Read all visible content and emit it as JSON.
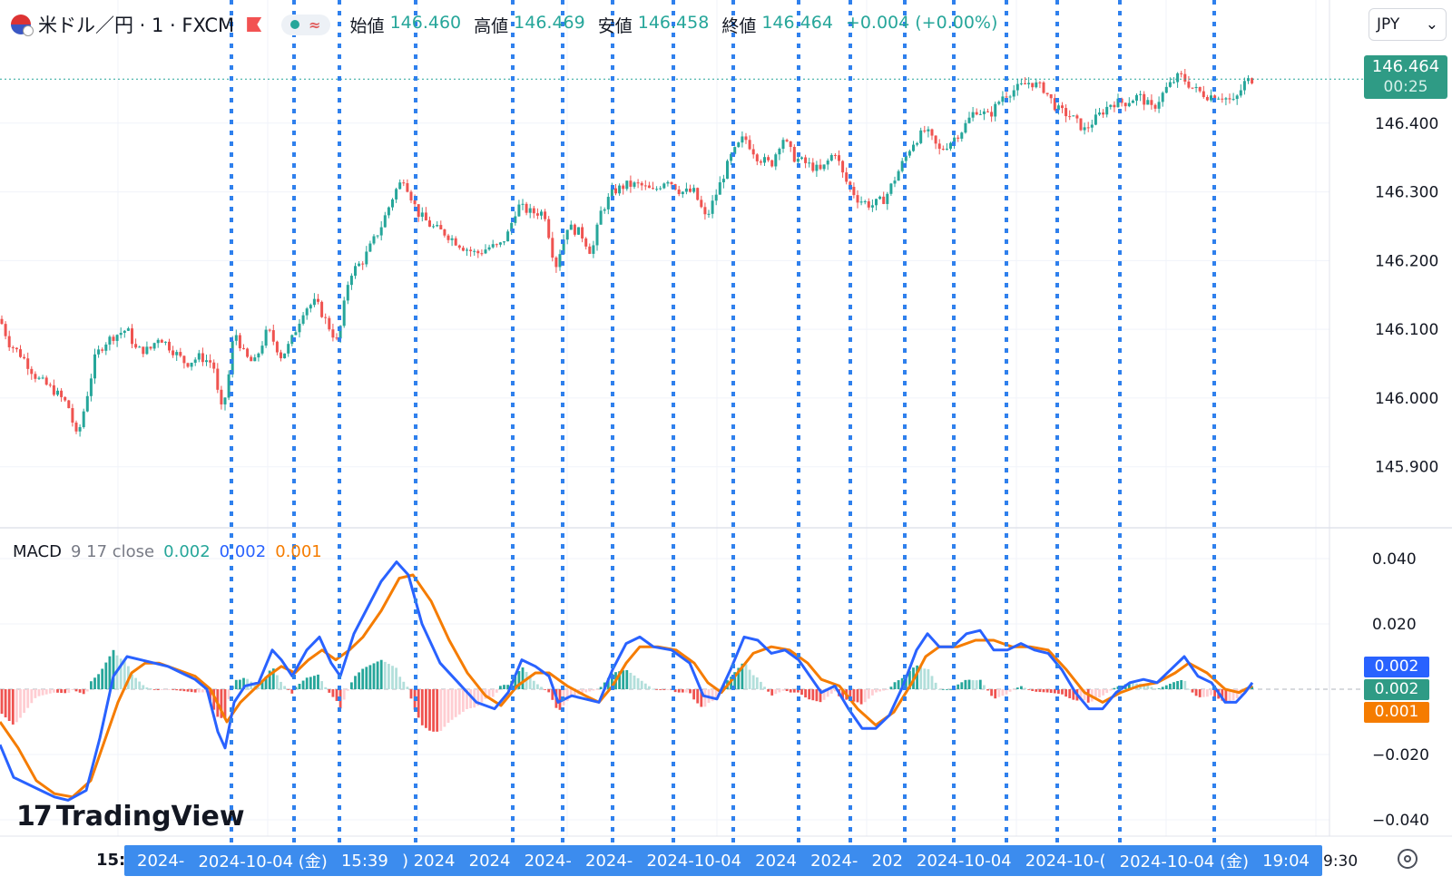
{
  "header": {
    "symbol": "米ドル／円 · 1 · FXCM",
    "wave_glyph": "≈",
    "ohlc": [
      {
        "label": "始値",
        "value": "146.460"
      },
      {
        "label": "高値",
        "value": "146.469"
      },
      {
        "label": "安値",
        "value": "146.458"
      },
      {
        "label": "終値",
        "value": "146.464"
      }
    ],
    "change": "+0.004 (+0.00%)"
  },
  "currency_selector": {
    "value": "JPY",
    "chevron": "chevron-down-icon"
  },
  "last_price_badge": {
    "price": "146.464",
    "countdown": "00:25"
  },
  "indicator": {
    "name": "MACD",
    "params": "9 17 close",
    "values": [
      "0.002",
      "0.002",
      "0.001"
    ],
    "badges": [
      "0.002",
      "0.002",
      "0.001"
    ]
  },
  "logo": {
    "mark": "17",
    "text": "TradingView"
  },
  "x_axis": {
    "left_cut": "15:",
    "labels": [
      "2024-",
      "2024-10-04 (金)",
      "15:39",
      ") 2024",
      "2024",
      "2024-",
      "2024-",
      "2024-10-04",
      "2024",
      "2024-",
      "202",
      "2024-10-04",
      "2024-10-(",
      "2024-10-04 (金)",
      "19:04"
    ],
    "right_cut": "9:30"
  },
  "colors": {
    "up": "#26a69a",
    "down": "#ef5350",
    "macd_line": "#2962ff",
    "signal_line": "#f57c00",
    "hist_up_strong": "#26a69a",
    "hist_up_weak": "#b2dfdb",
    "hist_down_strong": "#ef5350",
    "hist_down_weak": "#ffcdd2",
    "vline": "#2f80ed",
    "xbar": "#3c8cee"
  },
  "chart_data": [
    {
      "type": "candlestick",
      "ylim": [
        145.86,
        146.5
      ],
      "yticks": [
        "146.400",
        "146.300",
        "146.200",
        "146.100",
        "146.000",
        "145.900"
      ],
      "close_path": [
        [
          0,
          146.115
        ],
        [
          10,
          146.08
        ],
        [
          25,
          146.06
        ],
        [
          40,
          146.03
        ],
        [
          60,
          146.01
        ],
        [
          75,
          145.99
        ],
        [
          85,
          145.94
        ],
        [
          92,
          145.98
        ],
        [
          105,
          146.06
        ],
        [
          115,
          146.08
        ],
        [
          125,
          146.09
        ],
        [
          140,
          146.1
        ],
        [
          150,
          146.07
        ],
        [
          165,
          146.07
        ],
        [
          175,
          146.09
        ],
        [
          190,
          146.07
        ],
        [
          205,
          146.05
        ],
        [
          220,
          146.06
        ],
        [
          235,
          146.05
        ],
        [
          243,
          145.98
        ],
        [
          250,
          146.01
        ],
        [
          258,
          146.1
        ],
        [
          270,
          146.06
        ],
        [
          280,
          146.05
        ],
        [
          295,
          146.1
        ],
        [
          310,
          146.06
        ],
        [
          320,
          146.08
        ],
        [
          335,
          146.13
        ],
        [
          348,
          146.14
        ],
        [
          360,
          146.11
        ],
        [
          372,
          146.08
        ],
        [
          385,
          146.18
        ],
        [
          400,
          146.2
        ],
        [
          420,
          146.25
        ],
        [
          435,
          146.3
        ],
        [
          445,
          146.32
        ],
        [
          460,
          146.27
        ],
        [
          475,
          146.25
        ],
        [
          490,
          146.24
        ],
        [
          510,
          146.22
        ],
        [
          525,
          146.21
        ],
        [
          540,
          146.22
        ],
        [
          550,
          146.22
        ],
        [
          560,
          146.24
        ],
        [
          570,
          146.28
        ],
        [
          585,
          146.27
        ],
        [
          600,
          146.27
        ],
        [
          612,
          146.19
        ],
        [
          625,
          146.25
        ],
        [
          640,
          146.24
        ],
        [
          652,
          146.21
        ],
        [
          662,
          146.27
        ],
        [
          675,
          146.3
        ],
        [
          690,
          146.31
        ],
        [
          705,
          146.31
        ],
        [
          720,
          146.3
        ],
        [
          735,
          146.32
        ],
        [
          750,
          146.3
        ],
        [
          765,
          146.3
        ],
        [
          778,
          146.26
        ],
        [
          790,
          146.3
        ],
        [
          805,
          146.35
        ],
        [
          820,
          146.38
        ],
        [
          835,
          146.35
        ],
        [
          850,
          146.34
        ],
        [
          862,
          146.38
        ],
        [
          875,
          146.35
        ],
        [
          890,
          146.34
        ],
        [
          905,
          146.33
        ],
        [
          920,
          146.36
        ],
        [
          930,
          146.32
        ],
        [
          945,
          146.29
        ],
        [
          960,
          146.28
        ],
        [
          975,
          146.29
        ],
        [
          990,
          146.33
        ],
        [
          1005,
          146.37
        ],
        [
          1020,
          146.39
        ],
        [
          1035,
          146.36
        ],
        [
          1045,
          146.37
        ],
        [
          1060,
          146.39
        ],
        [
          1075,
          146.42
        ],
        [
          1090,
          146.41
        ],
        [
          1105,
          146.44
        ],
        [
          1120,
          146.45
        ],
        [
          1135,
          146.46
        ],
        [
          1150,
          146.45
        ],
        [
          1165,
          146.42
        ],
        [
          1180,
          146.41
        ],
        [
          1195,
          146.39
        ],
        [
          1210,
          146.41
        ],
        [
          1225,
          146.43
        ],
        [
          1240,
          146.43
        ],
        [
          1255,
          146.44
        ],
        [
          1270,
          146.42
        ],
        [
          1285,
          146.45
        ],
        [
          1300,
          146.47
        ],
        [
          1315,
          146.45
        ],
        [
          1330,
          146.44
        ],
        [
          1345,
          146.44
        ],
        [
          1360,
          146.43
        ],
        [
          1372,
          146.46
        ],
        [
          1380,
          146.464
        ]
      ]
    },
    {
      "type": "line",
      "title": "MACD 9 17 close",
      "ylim": [
        -0.045,
        0.045
      ],
      "yticks": [
        "0.040",
        "0.020",
        "−0.020",
        "−0.040"
      ],
      "series": [
        {
          "name": "",
          "role": "macd",
          "points": [
            [
              0,
              -0.017
            ],
            [
              15,
              -0.027
            ],
            [
              30,
              -0.029
            ],
            [
              45,
              -0.031
            ],
            [
              60,
              -0.033
            ],
            [
              75,
              -0.034
            ],
            [
              95,
              -0.031
            ],
            [
              110,
              -0.015
            ],
            [
              125,
              0.004
            ],
            [
              140,
              0.01
            ],
            [
              155,
              0.009
            ],
            [
              170,
              0.008
            ],
            [
              185,
              0.007
            ],
            [
              200,
              0.005
            ],
            [
              215,
              0.003
            ],
            [
              228,
              0.0
            ],
            [
              240,
              -0.013
            ],
            [
              248,
              -0.018
            ],
            [
              258,
              -0.004
            ],
            [
              270,
              0.001
            ],
            [
              285,
              0.002
            ],
            [
              300,
              0.012
            ],
            [
              310,
              0.009
            ],
            [
              322,
              0.004
            ],
            [
              338,
              0.012
            ],
            [
              352,
              0.016
            ],
            [
              365,
              0.008
            ],
            [
              375,
              0.004
            ],
            [
              390,
              0.017
            ],
            [
              405,
              0.025
            ],
            [
              420,
              0.033
            ],
            [
              437,
              0.039
            ],
            [
              450,
              0.035
            ],
            [
              465,
              0.02
            ],
            [
              485,
              0.008
            ],
            [
              505,
              0.002
            ],
            [
              525,
              -0.004
            ],
            [
              545,
              -0.006
            ],
            [
              560,
              -0.001
            ],
            [
              575,
              0.009
            ],
            [
              590,
              0.007
            ],
            [
              605,
              0.004
            ],
            [
              615,
              -0.004
            ],
            [
              630,
              -0.002
            ],
            [
              645,
              -0.003
            ],
            [
              660,
              -0.004
            ],
            [
              675,
              0.006
            ],
            [
              690,
              0.014
            ],
            [
              705,
              0.016
            ],
            [
              720,
              0.013
            ],
            [
              740,
              0.012
            ],
            [
              760,
              0.008
            ],
            [
              775,
              -0.002
            ],
            [
              790,
              -0.003
            ],
            [
              805,
              0.006
            ],
            [
              820,
              0.016
            ],
            [
              835,
              0.015
            ],
            [
              850,
              0.011
            ],
            [
              865,
              0.012
            ],
            [
              880,
              0.009
            ],
            [
              895,
              0.003
            ],
            [
              905,
              -0.001
            ],
            [
              920,
              0.001
            ],
            [
              935,
              -0.006
            ],
            [
              950,
              -0.012
            ],
            [
              965,
              -0.012
            ],
            [
              980,
              -0.008
            ],
            [
              995,
              0.001
            ],
            [
              1010,
              0.012
            ],
            [
              1022,
              0.017
            ],
            [
              1035,
              0.013
            ],
            [
              1050,
              0.013
            ],
            [
              1065,
              0.017
            ],
            [
              1080,
              0.018
            ],
            [
              1095,
              0.012
            ],
            [
              1110,
              0.012
            ],
            [
              1125,
              0.014
            ],
            [
              1140,
              0.012
            ],
            [
              1155,
              0.011
            ],
            [
              1170,
              0.006
            ],
            [
              1185,
              -0.001
            ],
            [
              1200,
              -0.006
            ],
            [
              1215,
              -0.006
            ],
            [
              1230,
              -0.001
            ],
            [
              1245,
              0.002
            ],
            [
              1260,
              0.003
            ],
            [
              1275,
              0.002
            ],
            [
              1290,
              0.006
            ],
            [
              1305,
              0.01
            ],
            [
              1320,
              0.004
            ],
            [
              1335,
              0.002
            ],
            [
              1350,
              -0.004
            ],
            [
              1362,
              -0.004
            ],
            [
              1372,
              -0.001
            ],
            [
              1380,
              0.002
            ]
          ]
        },
        {
          "name": "",
          "role": "signal",
          "points": [
            [
              0,
              -0.01
            ],
            [
              20,
              -0.018
            ],
            [
              40,
              -0.028
            ],
            [
              60,
              -0.032
            ],
            [
              80,
              -0.033
            ],
            [
              100,
              -0.028
            ],
            [
              115,
              -0.016
            ],
            [
              130,
              -0.004
            ],
            [
              145,
              0.005
            ],
            [
              160,
              0.008
            ],
            [
              175,
              0.008
            ],
            [
              195,
              0.006
            ],
            [
              215,
              0.004
            ],
            [
              232,
              0.0
            ],
            [
              250,
              -0.01
            ],
            [
              265,
              -0.004
            ],
            [
              280,
              0.0
            ],
            [
              295,
              0.004
            ],
            [
              310,
              0.007
            ],
            [
              325,
              0.005
            ],
            [
              340,
              0.009
            ],
            [
              355,
              0.012
            ],
            [
              370,
              0.009
            ],
            [
              385,
              0.012
            ],
            [
              400,
              0.016
            ],
            [
              420,
              0.024
            ],
            [
              440,
              0.034
            ],
            [
              455,
              0.035
            ],
            [
              475,
              0.027
            ],
            [
              495,
              0.015
            ],
            [
              515,
              0.005
            ],
            [
              535,
              -0.002
            ],
            [
              552,
              -0.005
            ],
            [
              570,
              0.001
            ],
            [
              590,
              0.005
            ],
            [
              605,
              0.005
            ],
            [
              625,
              0.001
            ],
            [
              645,
              -0.002
            ],
            [
              660,
              -0.004
            ],
            [
              675,
              0.001
            ],
            [
              690,
              0.008
            ],
            [
              705,
              0.013
            ],
            [
              725,
              0.013
            ],
            [
              745,
              0.012
            ],
            [
              765,
              0.008
            ],
            [
              780,
              0.002
            ],
            [
              795,
              -0.001
            ],
            [
              810,
              0.004
            ],
            [
              830,
              0.011
            ],
            [
              850,
              0.013
            ],
            [
              870,
              0.012
            ],
            [
              890,
              0.008
            ],
            [
              905,
              0.003
            ],
            [
              925,
              0.001
            ],
            [
              945,
              -0.006
            ],
            [
              965,
              -0.011
            ],
            [
              985,
              -0.007
            ],
            [
              1005,
              0.002
            ],
            [
              1020,
              0.01
            ],
            [
              1035,
              0.013
            ],
            [
              1055,
              0.013
            ],
            [
              1075,
              0.015
            ],
            [
              1095,
              0.015
            ],
            [
              1115,
              0.013
            ],
            [
              1135,
              0.013
            ],
            [
              1155,
              0.012
            ],
            [
              1175,
              0.006
            ],
            [
              1195,
              -0.001
            ],
            [
              1215,
              -0.004
            ],
            [
              1235,
              -0.001
            ],
            [
              1255,
              0.001
            ],
            [
              1275,
              0.002
            ],
            [
              1295,
              0.005
            ],
            [
              1310,
              0.008
            ],
            [
              1330,
              0.005
            ],
            [
              1350,
              0.0
            ],
            [
              1365,
              -0.001
            ],
            [
              1380,
              0.001
            ]
          ]
        }
      ]
    }
  ]
}
